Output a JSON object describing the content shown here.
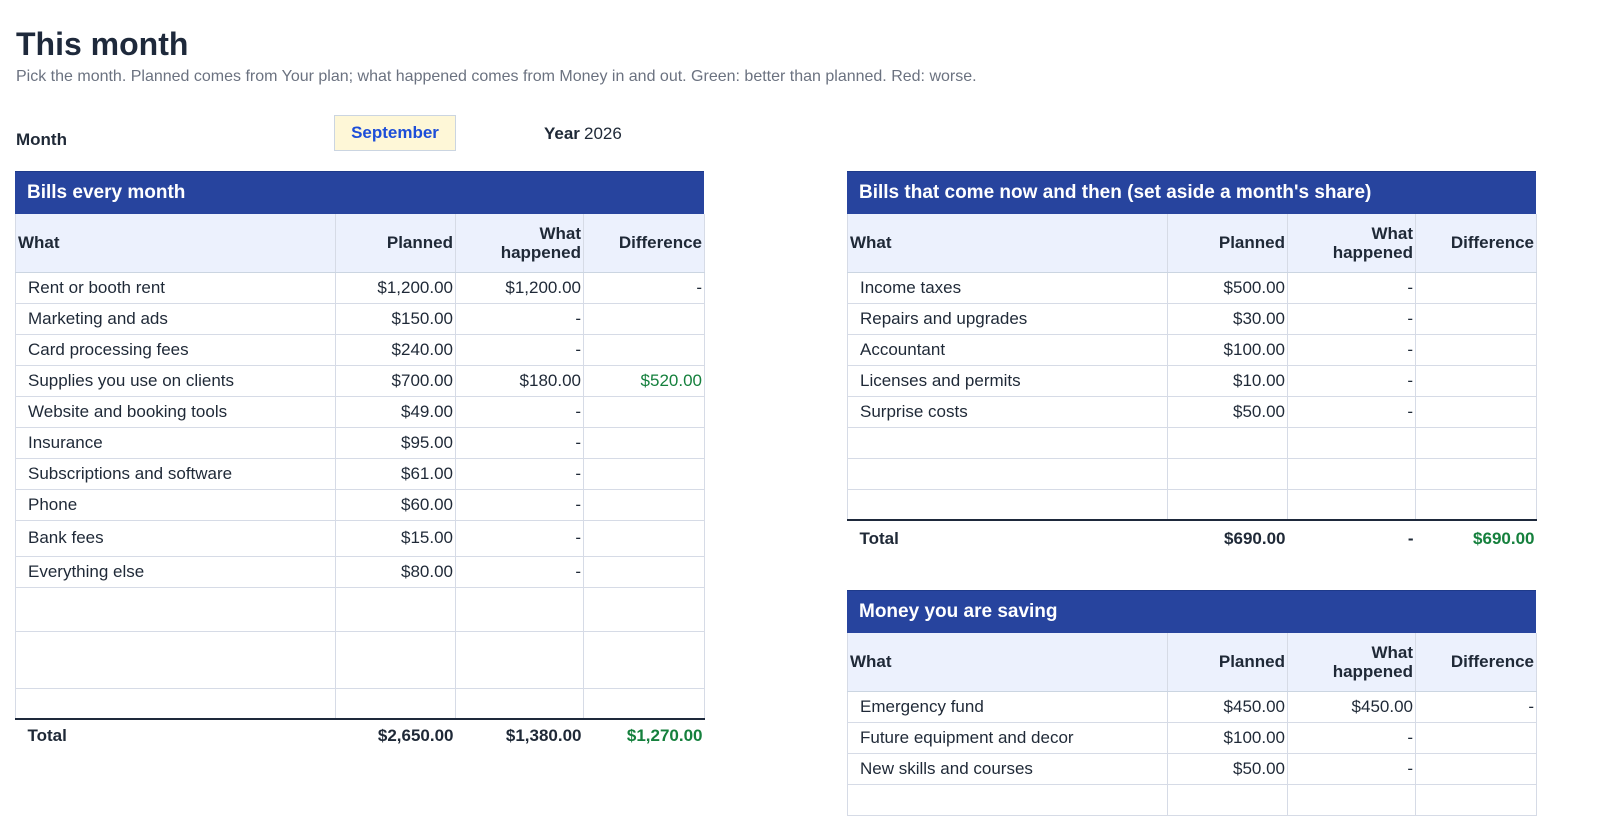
{
  "page": {
    "title": "This month",
    "subtitle": "Pick the month. Planned comes from Your plan; what happened comes from Money in and out. Green: better than planned. Red: worse."
  },
  "controls": {
    "month_label": "Month",
    "month_value": "September",
    "year_label": "Year",
    "year_value": "2026"
  },
  "colors": {
    "header_bar": "#27449e",
    "column_header_bg": "#ecf1fd",
    "month_cell_bg": "#fef7d7",
    "better_than_planned": "#15803d"
  },
  "monthly_bills": {
    "title": "Bills every month",
    "columns": [
      "What",
      "Planned",
      "What happened",
      "Difference"
    ],
    "rows": [
      {
        "what": "Rent or booth rent",
        "planned": "$1,200.00",
        "happened": "$1,200.00",
        "difference": "-"
      },
      {
        "what": "Marketing and ads",
        "planned": "$150.00",
        "happened": "-",
        "difference": ""
      },
      {
        "what": "Card processing fees",
        "planned": "$240.00",
        "happened": "-",
        "difference": ""
      },
      {
        "what": "Supplies you use on clients",
        "planned": "$700.00",
        "happened": "$180.00",
        "difference": "$520.00"
      },
      {
        "what": "Website and booking tools",
        "planned": "$49.00",
        "happened": "-",
        "difference": ""
      },
      {
        "what": "Insurance",
        "planned": "$95.00",
        "happened": "-",
        "difference": ""
      },
      {
        "what": "Subscriptions and software",
        "planned": "$61.00",
        "happened": "-",
        "difference": ""
      },
      {
        "what": "Phone",
        "planned": "$60.00",
        "happened": "-",
        "difference": ""
      },
      {
        "what": "Bank fees",
        "planned": "$15.00",
        "happened": "-",
        "difference": ""
      },
      {
        "what": "Everything else",
        "planned": "$80.00",
        "happened": "-",
        "difference": ""
      }
    ],
    "total": {
      "label": "Total",
      "planned": "$2,650.00",
      "happened": "$1,380.00",
      "difference": "$1,270.00"
    }
  },
  "occasional_bills": {
    "title": "Bills that come now and then (set aside a month's share)",
    "columns": [
      "What",
      "Planned",
      "What happened",
      "Difference"
    ],
    "rows": [
      {
        "what": "Income taxes",
        "planned": "$500.00",
        "happened": "-",
        "difference": ""
      },
      {
        "what": "Repairs and upgrades",
        "planned": "$30.00",
        "happened": "-",
        "difference": ""
      },
      {
        "what": "Accountant",
        "planned": "$100.00",
        "happened": "-",
        "difference": ""
      },
      {
        "what": "Licenses and permits",
        "planned": "$10.00",
        "happened": "-",
        "difference": ""
      },
      {
        "what": "Surprise costs",
        "planned": "$50.00",
        "happened": "-",
        "difference": ""
      }
    ],
    "total": {
      "label": "Total",
      "planned": "$690.00",
      "happened": "-",
      "difference": "$690.00"
    }
  },
  "savings": {
    "title": "Money you are saving",
    "columns": [
      "What",
      "Planned",
      "What happened",
      "Difference"
    ],
    "rows": [
      {
        "what": "Emergency fund",
        "planned": "$450.00",
        "happened": "$450.00",
        "difference": "-"
      },
      {
        "what": "Future equipment and decor",
        "planned": "$100.00",
        "happened": "-",
        "difference": ""
      },
      {
        "what": "New skills and courses",
        "planned": "$50.00",
        "happened": "-",
        "difference": ""
      }
    ]
  }
}
